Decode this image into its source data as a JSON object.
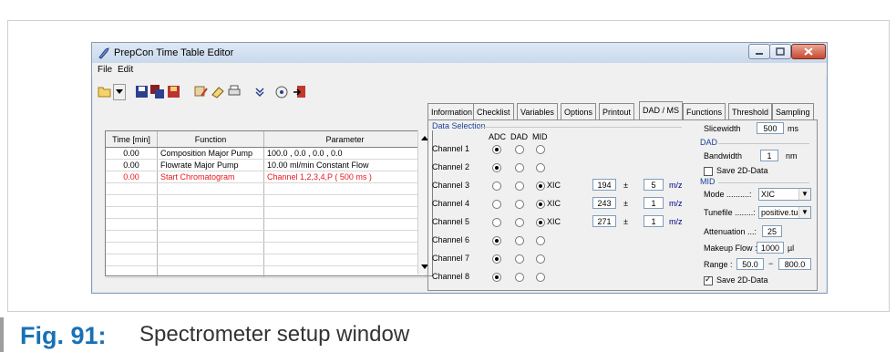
{
  "window": {
    "title": "PrepCon Time Table Editor",
    "menu": [
      "File",
      "Edit"
    ]
  },
  "toolbar": {
    "icons": [
      "open-folder-icon",
      "dropdown-arrow-icon",
      "save-icon",
      "save-all-icon",
      "save-as-icon",
      "table-edit-icon",
      "eraser-icon",
      "print-icon",
      "chevron-down-icon",
      "preview-icon",
      "exit-icon"
    ]
  },
  "table": {
    "headers": [
      "Time [min]",
      "Function",
      "Parameter"
    ],
    "rows": [
      {
        "time": "0.00",
        "function": "Composition Major Pump",
        "parameter": "100.0  ,  0.0  ,  0.0  ,  0.0"
      },
      {
        "time": "0.00",
        "function": "Flowrate Major Pump",
        "parameter": "10.00  ml/min Constant Flow"
      },
      {
        "time": "0.00",
        "function": "Start Chromatogram",
        "parameter": "Channel 1,2,3,4,P ( 500 ms )"
      }
    ],
    "highlight_color": "#e8171d"
  },
  "tabs": [
    "Information",
    "Checklist",
    "Variables",
    "Options",
    "Printout",
    "DAD / MS",
    "Functions",
    "Threshold",
    "Sampling"
  ],
  "active_tab": "DAD / MS",
  "data_selection": {
    "title": "Data Selection",
    "headers": [
      "ADC",
      "DAD",
      "MID"
    ],
    "channels": [
      {
        "name": "Channel 1",
        "selected": "ADC",
        "xic": false
      },
      {
        "name": "Channel 2",
        "selected": "ADC",
        "xic": false
      },
      {
        "name": "Channel 3",
        "selected": "MID",
        "xic": true,
        "xic_label": "XIC",
        "value": "194",
        "pm": "±",
        "tol": "5",
        "unit": "m/z"
      },
      {
        "name": "Channel 4",
        "selected": "MID",
        "xic": true,
        "xic_label": "XIC",
        "value": "243",
        "pm": "±",
        "tol": "1",
        "unit": "m/z"
      },
      {
        "name": "Channel 5",
        "selected": "MID",
        "xic": true,
        "xic_label": "XIC",
        "value": "271",
        "pm": "±",
        "tol": "1",
        "unit": "m/z"
      },
      {
        "name": "Channel 6",
        "selected": "ADC",
        "xic": false
      },
      {
        "name": "Channel 7",
        "selected": "ADC",
        "xic": false
      },
      {
        "name": "Channel 8",
        "selected": "ADC",
        "xic": false
      }
    ]
  },
  "settings": {
    "slicewidth_label": "Slicewidth",
    "slicewidth_value": "500",
    "slicewidth_unit": "ms",
    "dad_label": "DAD",
    "bandwidth_label": "Bandwidth",
    "bandwidth_value": "1",
    "bandwidth_unit": "nm",
    "save_2d_dad_label": "Save 2D-Data",
    "save_2d_dad_checked": false,
    "mid_label": "MID",
    "mode_label": "Mode ..........:",
    "mode_value": "XIC",
    "tunefile_label": "Tunefile ........:",
    "tunefile_value": "positive.tu",
    "attenuation_label": "Attenuation ...:",
    "attenuation_value": "25",
    "makeup_label": "Makeup Flow :",
    "makeup_value": "1000",
    "makeup_unit": "µl",
    "range_label": "Range :",
    "range_from": "50.0",
    "range_sep": "−",
    "range_to": "800.0",
    "save_2d_mid_label": "Save 2D-Data",
    "save_2d_mid_checked": true
  },
  "caption": {
    "figure": "Fig. 91:",
    "text": "Spectrometer setup window"
  }
}
